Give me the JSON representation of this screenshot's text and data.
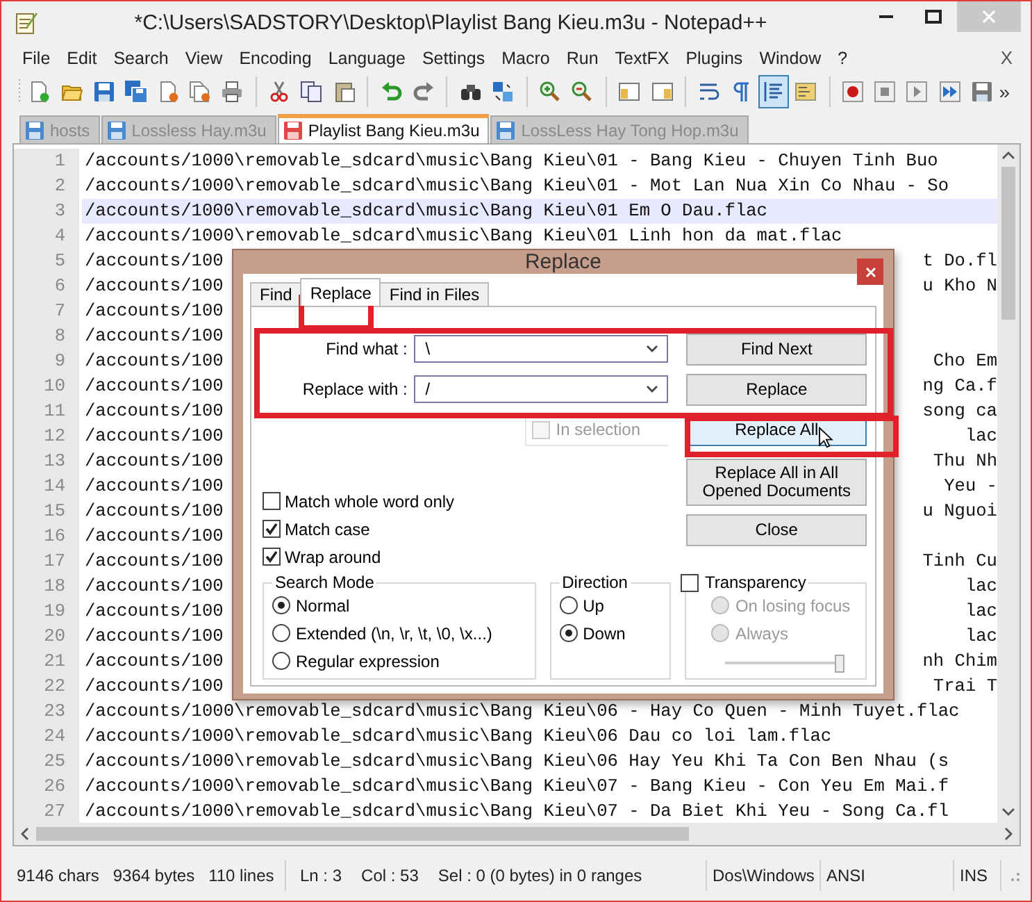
{
  "window": {
    "title": "*C:\\Users\\SADSTORY\\Desktop\\Playlist Bang Kieu.m3u - Notepad++"
  },
  "menu": [
    "File",
    "Edit",
    "Search",
    "View",
    "Encoding",
    "Language",
    "Settings",
    "Macro",
    "Run",
    "TextFX",
    "Plugins",
    "Window",
    "?"
  ],
  "menu_close": "X",
  "toolbar": [
    {
      "pressed": false
    },
    {
      "pressed": false
    },
    {
      "pressed": false
    },
    {
      "pressed": false
    },
    {
      "pressed": false
    },
    {
      "pressed": false
    },
    {
      "pressed": false
    },
    {
      "pressed": false
    },
    {
      "pressed": false
    },
    {
      "pressed": false
    },
    {
      "pressed": false
    },
    {
      "pressed": false
    },
    {
      "pressed": false
    },
    {
      "pressed": false
    },
    {
      "pressed": false
    },
    {
      "pressed": false
    },
    {
      "pressed": false
    },
    {
      "pressed": false
    },
    {
      "pressed": false
    },
    {
      "pressed": false
    },
    {
      "pressed": true
    },
    {
      "pressed": false
    },
    {
      "pressed": false
    },
    {
      "pressed": false
    },
    {
      "pressed": false
    },
    {
      "pressed": false
    },
    {
      "pressed": false
    }
  ],
  "toolbar_overflow": "»",
  "tabs": [
    {
      "label": "hosts",
      "selected": false
    },
    {
      "label": "Lossless Hay.m3u",
      "selected": false
    },
    {
      "label": "Playlist Bang Kieu.m3u",
      "selected": true
    },
    {
      "label": "LossLess Hay Tong Hop.m3u",
      "selected": false
    }
  ],
  "editor": {
    "lines": [
      {
        "number": "1",
        "text": "/accounts/1000\\removable_sdcard\\music\\Bang Kieu\\01 - Bang Kieu - Chuyen Tinh Buo",
        "current": false
      },
      {
        "number": "2",
        "text": "/accounts/1000\\removable_sdcard\\music\\Bang Kieu\\01 - Mot Lan Nua Xin Co Nhau - So",
        "current": false
      },
      {
        "number": "3",
        "text": "/accounts/1000\\removable_sdcard\\music\\Bang Kieu\\01 Em O Dau.flac",
        "current": true
      },
      {
        "number": "4",
        "text": "/accounts/1000\\removable_sdcard\\music\\Bang Kieu\\01 Linh hon da mat.flac",
        "current": false
      },
      {
        "number": "5",
        "text": "/accounts/100",
        "tail": "t Do.fl",
        "current": false
      },
      {
        "number": "6",
        "text": "/accounts/100",
        "tail": "u Kho N",
        "current": false
      },
      {
        "number": "7",
        "text": "/accounts/100",
        "current": false
      },
      {
        "number": "8",
        "text": "/accounts/100",
        "current": false
      },
      {
        "number": "9",
        "text": "/accounts/100",
        "tail": "Cho Em",
        "current": false
      },
      {
        "number": "10",
        "text": "/accounts/100",
        "tail": "ng Ca.f",
        "current": false
      },
      {
        "number": "11",
        "text": "/accounts/100",
        "tail": "song ca",
        "current": false
      },
      {
        "number": "12",
        "text": "/accounts/100",
        "tail": "lac",
        "current": false
      },
      {
        "number": "13",
        "text": "/accounts/100",
        "tail": "Thu Nh",
        "current": false
      },
      {
        "number": "14",
        "text": "/accounts/100",
        "tail": "Yeu -",
        "current": false
      },
      {
        "number": "15",
        "text": "/accounts/100",
        "tail": "u Nguoi",
        "current": false
      },
      {
        "number": "16",
        "text": "/accounts/100",
        "current": false
      },
      {
        "number": "17",
        "text": "/accounts/100",
        "tail": "Tinh Cu",
        "current": false
      },
      {
        "number": "18",
        "text": "/accounts/100",
        "tail": "lac",
        "current": false
      },
      {
        "number": "19",
        "text": "/accounts/100",
        "tail": "lac",
        "current": false
      },
      {
        "number": "20",
        "text": "/accounts/100",
        "tail": "lac",
        "current": false
      },
      {
        "number": "21",
        "text": "/accounts/100",
        "tail": "nh Chim",
        "current": false
      },
      {
        "number": "22",
        "text": "/accounts/100",
        "tail": "Trai T",
        "current": false
      },
      {
        "number": "23",
        "text": "/accounts/1000\\removable_sdcard\\music\\Bang Kieu\\06 - Hay Co Quen - Minh Tuyet.flac",
        "current": false
      },
      {
        "number": "24",
        "text": "/accounts/1000\\removable_sdcard\\music\\Bang Kieu\\06 Dau co loi lam.flac",
        "current": false
      },
      {
        "number": "25",
        "text": "/accounts/1000\\removable_sdcard\\music\\Bang Kieu\\06 Hay Yeu Khi Ta Con Ben Nhau (s",
        "current": false
      },
      {
        "number": "26",
        "text": "/accounts/1000\\removable_sdcard\\music\\Bang Kieu\\07 - Bang Kieu - Con Yeu Em Mai.f",
        "current": false
      },
      {
        "number": "27",
        "text": "/accounts/1000\\removable_sdcard\\music\\Bang Kieu\\07 - Da Biet Khi Yeu - Song Ca.fl",
        "current": false
      }
    ]
  },
  "dialog": {
    "title": "Replace",
    "tabs": [
      {
        "label": "Find",
        "selected": false
      },
      {
        "label": "Replace",
        "selected": true
      },
      {
        "label": "Find in Files",
        "selected": false
      }
    ],
    "fields": [
      {
        "label": "Find what :",
        "value": "\\"
      },
      {
        "label": "Replace with :",
        "value": "/"
      }
    ],
    "in_selection": {
      "label": "In selection",
      "checked": false,
      "disabled": true
    },
    "buttons": [
      {
        "label": "Find Next",
        "hovered": false
      },
      {
        "label": "Replace",
        "hovered": false
      },
      {
        "label": "Replace All",
        "hovered": true
      },
      {
        "label": "Replace All in All Opened Documents",
        "hovered": false
      },
      {
        "label": "Close",
        "hovered": false
      }
    ],
    "options": [
      {
        "label": "Match whole word only",
        "checked": false
      },
      {
        "label": "Match case",
        "checked": true
      },
      {
        "label": "Wrap around",
        "checked": true
      }
    ],
    "search_mode": {
      "title": "Search Mode",
      "options": [
        {
          "label": "Normal",
          "selected": true
        },
        {
          "label": "Extended (\\n, \\r, \\t, \\0, \\x...)",
          "selected": false
        },
        {
          "label": "Regular expression",
          "selected": false
        }
      ]
    },
    "direction": {
      "title": "Direction",
      "options": [
        {
          "label": "Up",
          "selected": false
        },
        {
          "label": "Down",
          "selected": true
        }
      ]
    },
    "transparency": {
      "label": "Transparency",
      "checked": false,
      "options": [
        {
          "label": "On losing focus",
          "selected": false,
          "disabled": true
        },
        {
          "label": "Always",
          "selected": false,
          "disabled": true
        }
      ],
      "slider": {
        "level": 1,
        "disabled": true
      }
    }
  },
  "status_bar": [
    [
      "9146 chars",
      "9364 bytes",
      "110 lines"
    ],
    [
      "Ln : 3",
      "Col : 53",
      "Sel : 0 (0 bytes) in 0 ranges"
    ],
    [
      "Dos\\Windows"
    ],
    [
      "ANSI"
    ],
    [
      "INS"
    ]
  ]
}
